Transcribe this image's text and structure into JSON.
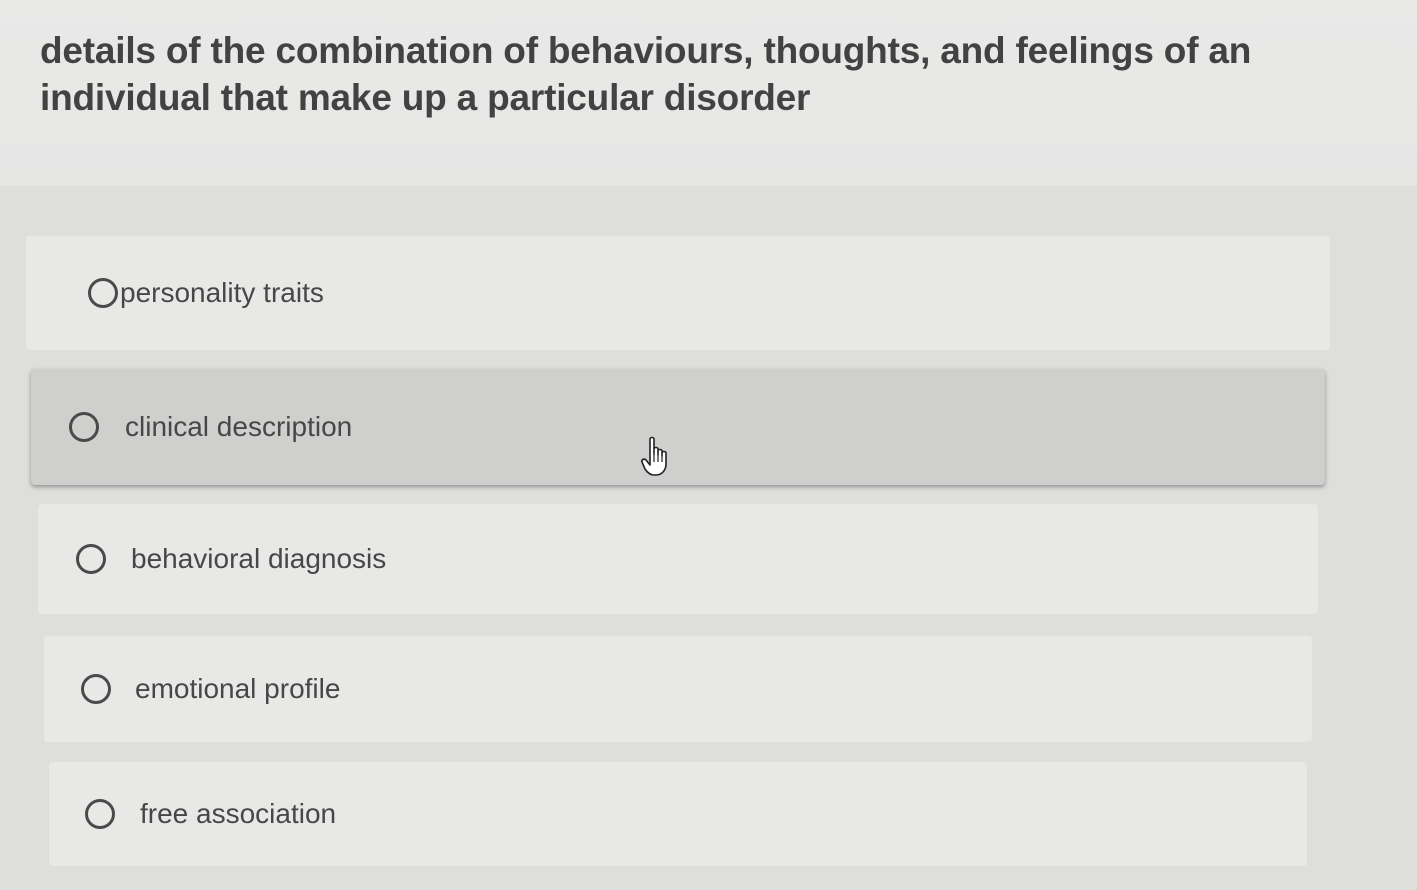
{
  "question": {
    "text": "details of the combination of behaviours, thoughts, and feelings of an individual that make up a particular disorder"
  },
  "options": [
    {
      "label": "personality traits",
      "selected": false,
      "hovered": false
    },
    {
      "label": "clinical description",
      "selected": false,
      "hovered": true
    },
    {
      "label": "behavioral diagnosis",
      "selected": false,
      "hovered": false
    },
    {
      "label": "emotional profile",
      "selected": false,
      "hovered": false
    },
    {
      "label": "free association",
      "selected": false,
      "hovered": false
    }
  ],
  "cursor": {
    "icon": "hand-pointer-icon"
  }
}
